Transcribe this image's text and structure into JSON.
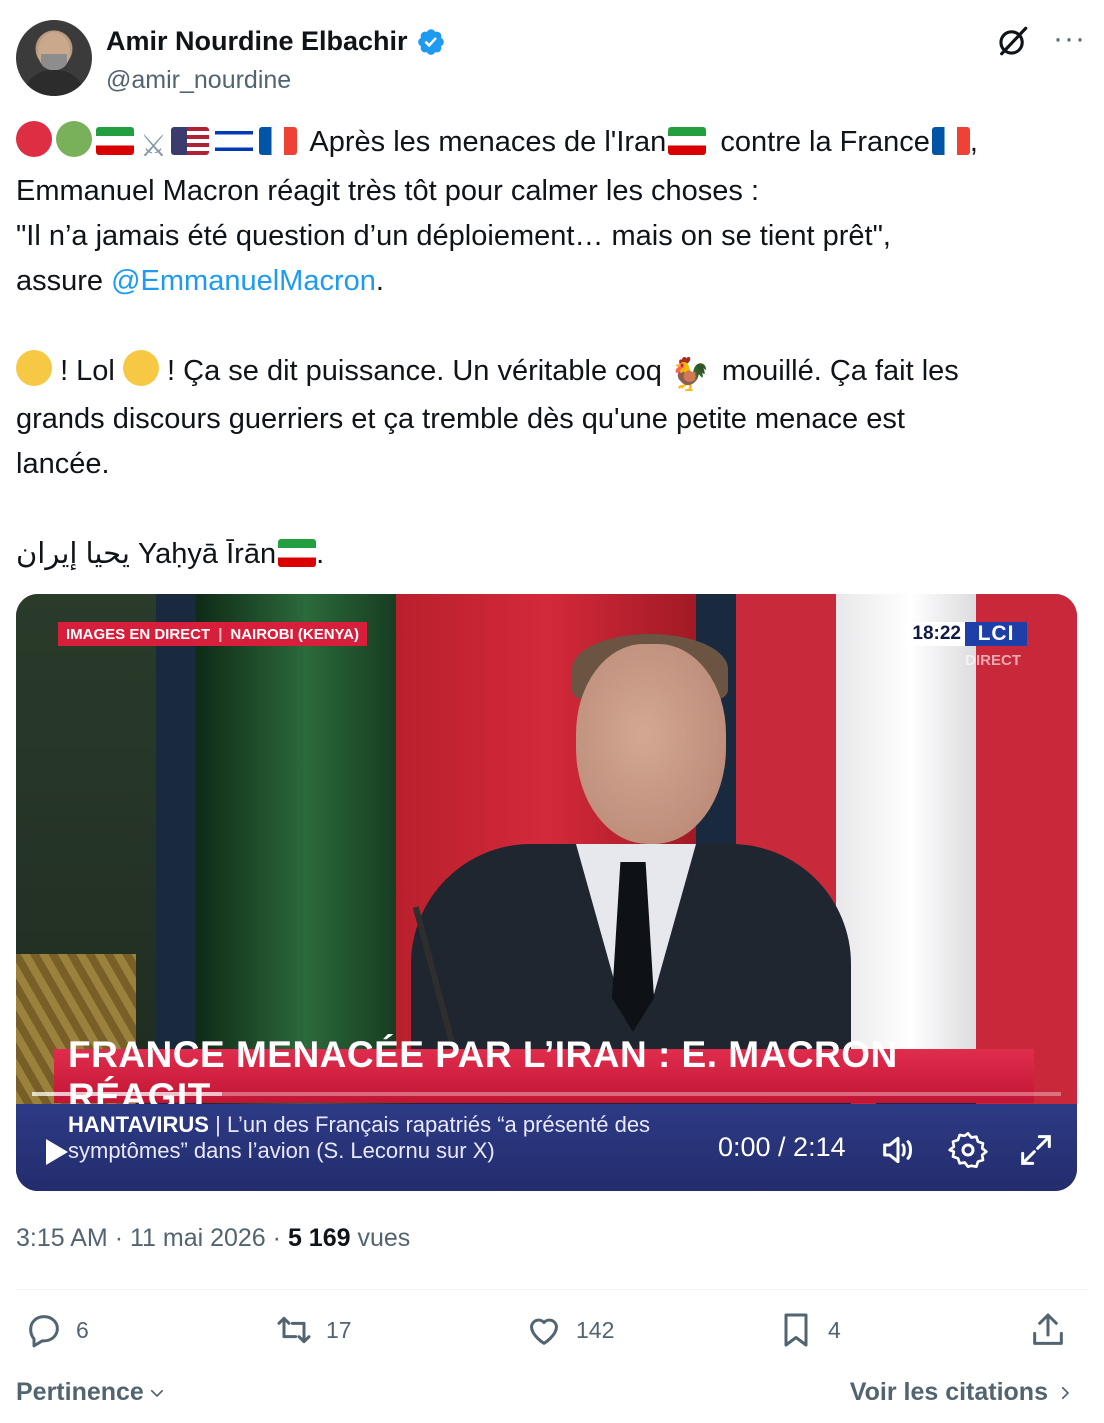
{
  "author": {
    "display_name": "Amir Nourdine Elbachir",
    "handle": "@amir_nourdine",
    "verified": true
  },
  "icons": {
    "verified": "verified-badge-icon",
    "grok": "grok-icon",
    "more": "more-options-icon",
    "reply": "reply-icon",
    "repost": "repost-icon",
    "like": "like-icon",
    "bookmark": "bookmark-icon",
    "share": "share-icon"
  },
  "tweet": {
    "line1": "Après les menaces de l'Iran",
    "line1b": "contre la France",
    "line1c": ",",
    "line2": "Emmanuel Macron réagit très tôt pour calmer les choses :",
    "line3": "\"Il n’a jamais été question d’un déploiement… mais on se tient prêt\",",
    "line4_pre": "assure ",
    "mention": "@EmmanuelMacron",
    "line4_post": ".",
    "line5a": "! Lol",
    "line5b": "! Ça se dit puissance. Un véritable coq",
    "line5c": "mouillé. Ça fait les",
    "line6": "grands discours guerriers et ça tremble dès qu'une petite menace est",
    "line7": "lancée.",
    "line8": "يحيا إيران Yaḥyā Īrān",
    "line8b": "."
  },
  "video": {
    "live_label": "IMAGES EN DIRECT",
    "location": "NAIROBI (KENYA)",
    "clock": "18:22",
    "channel": "LCI",
    "direct": "DIRECT",
    "headline": "FRANCE MENACÉE PAR L’IRAN : E. MACRON RÉAGIT",
    "ticker_label": "HANTAVIRUS",
    "ticker_sep": "|",
    "ticker_line1": "L’un des Français rapatriés “a présenté des",
    "ticker_line2": "symptômes” dans l’avion (S. Lecornu sur X)",
    "time": "0:00 / 2:14",
    "progress": 0.0
  },
  "meta": {
    "time": "3:15 AM",
    "sep": "·",
    "date": "11 mai 2026",
    "views": "5 169",
    "views_label": "vues"
  },
  "actions": {
    "replies": "6",
    "reposts": "17",
    "likes": "142",
    "bookmarks": "4"
  },
  "footer": {
    "sort_label": "Pertinence",
    "quotes_label": "Voir les citations"
  },
  "colors": {
    "accent": "#1d9bf0",
    "text": "#0f1419",
    "muted": "#536471",
    "news_red": "#d71f3c",
    "news_blue": "#232c6c"
  }
}
